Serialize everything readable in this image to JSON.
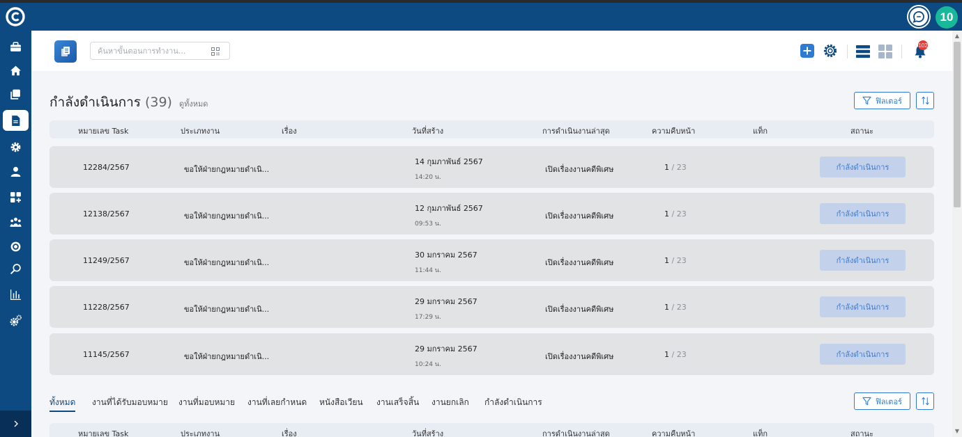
{
  "sidebar": {
    "logo": "logo-c-icon",
    "items": [
      {
        "icon": "briefcase-icon",
        "active": false
      },
      {
        "icon": "home-icon",
        "active": false
      },
      {
        "icon": "copy-icon",
        "active": false
      },
      {
        "icon": "document-icon",
        "active": true
      },
      {
        "icon": "settings-gear-icon",
        "active": false
      },
      {
        "icon": "user-icon",
        "active": false
      },
      {
        "icon": "apps-add-icon",
        "active": false
      },
      {
        "icon": "team-icon",
        "active": false
      },
      {
        "icon": "settings-circle-icon",
        "active": false
      },
      {
        "icon": "search-icon",
        "active": false
      },
      {
        "icon": "chart-icon",
        "active": false
      },
      {
        "icon": "gears-icon",
        "active": false
      }
    ],
    "expand_icon": "chevron-right-icon"
  },
  "topbar": {
    "chat_icon": "chat-icon",
    "user_initials": "10"
  },
  "header": {
    "search_placeholder": "ค้นหาขั้นตอนการทำงาน...",
    "notification_count": "102"
  },
  "in_progress": {
    "title": "กำลังดำเนินการ",
    "count": "(39)",
    "view_all": "ดูทั้งหมด",
    "filter_label": "ฟิลเตอร์"
  },
  "columns": {
    "task_no": "หมายเลข Task",
    "type": "ประเภทงาน",
    "subject": "เรื่อง",
    "created": "วันที่สร้าง",
    "latest": "การดำเนินงานล่าสุด",
    "progress": "ความคืบหน้า",
    "tag": "แท็ก",
    "status": "สถานะ"
  },
  "rows": [
    {
      "task_no": "12284/2567",
      "type": "ขอให้ฝ่ายกฎหมายดำเนิ...",
      "date": "14 กุมภาพันธ์ 2567",
      "time": "14:20 น.",
      "latest": "เปิดเรื่องงานคดีพิเศษ",
      "progress_done": "1",
      "progress_total": "/ 23",
      "status": "กำลังดำเนินการ"
    },
    {
      "task_no": "12138/2567",
      "type": "ขอให้ฝ่ายกฎหมายดำเนิ...",
      "date": "12 กุมภาพันธ์ 2567",
      "time": "09:53 น.",
      "latest": "เปิดเรื่องงานคดีพิเศษ",
      "progress_done": "1",
      "progress_total": "/ 23",
      "status": "กำลังดำเนินการ"
    },
    {
      "task_no": "11249/2567",
      "type": "ขอให้ฝ่ายกฎหมายดำเนิ...",
      "date": "30 มกราคม 2567",
      "time": "11:44 น.",
      "latest": "เปิดเรื่องงานคดีพิเศษ",
      "progress_done": "1",
      "progress_total": "/ 23",
      "status": "กำลังดำเนินการ"
    },
    {
      "task_no": "11228/2567",
      "type": "ขอให้ฝ่ายกฎหมายดำเนิ...",
      "date": "29 มกราคม 2567",
      "time": "17:29 น.",
      "latest": "เปิดเรื่องงานคดีพิเศษ",
      "progress_done": "1",
      "progress_total": "/ 23",
      "status": "กำลังดำเนินการ"
    },
    {
      "task_no": "11145/2567",
      "type": "ขอให้ฝ่ายกฎหมายดำเนิ...",
      "date": "29 มกราคม 2567",
      "time": "10:24 น.",
      "latest": "เปิดเรื่องงานคดีพิเศษ",
      "progress_done": "1",
      "progress_total": "/ 23",
      "status": "กำลังดำเนินการ"
    }
  ],
  "tabs": [
    {
      "label": "ทั้งหมด",
      "active": true
    },
    {
      "label": "งานที่ได้รับมอบหมาย",
      "active": false
    },
    {
      "label": "งานที่มอบหมาย",
      "active": false
    },
    {
      "label": "งานที่เลยกำหนด",
      "active": false
    },
    {
      "label": "หนังสือเวียน",
      "active": false
    },
    {
      "label": "งานเสร็จสิ้น",
      "active": false
    },
    {
      "label": "งานยกเลิก",
      "active": false
    },
    {
      "label": "กำลังดำเนินการ",
      "active": false
    }
  ],
  "bottom_filter_label": "ฟิลเตอร์",
  "colors": {
    "sidebar": "#0d4a82",
    "accent": "#2f7ad3",
    "status_bg": "#c3d2ea",
    "avatar": "#18b89a",
    "badge": "#e53935"
  }
}
